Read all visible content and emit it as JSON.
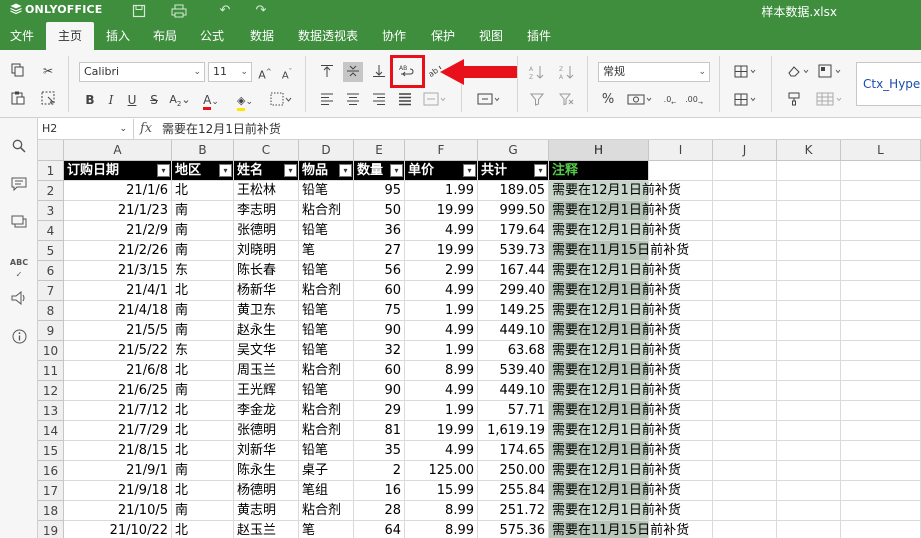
{
  "app": {
    "brand": "ONLYOFFICE",
    "filename": "样本数据.xlsx"
  },
  "menu": {
    "tabs": [
      "文件",
      "主页",
      "插入",
      "布局",
      "公式",
      "数据",
      "数据透视表",
      "协作",
      "保护",
      "视图",
      "插件"
    ],
    "active_index": 1
  },
  "toolbar": {
    "font_name": "Calibri",
    "font_size": "11",
    "number_format": "常规",
    "style_preview": "Ctx_Hype",
    "highlighted_button": "wrap-text-button",
    "arrow_color": "#e8101a"
  },
  "formula_bar": {
    "cell_ref": "H2",
    "fx_label": "fx",
    "value": "需要在12月1日前补货"
  },
  "grid": {
    "columns": [
      "A",
      "B",
      "C",
      "D",
      "E",
      "F",
      "G",
      "H",
      "I",
      "J",
      "K",
      "L"
    ],
    "selected_column": "H",
    "row_numbers": [
      "1",
      "2",
      "3",
      "4",
      "5",
      "6",
      "7",
      "8",
      "9",
      "10",
      "11",
      "12",
      "13",
      "14",
      "15",
      "16",
      "17",
      "18",
      "19"
    ],
    "header_row": [
      "订购日期",
      "地区",
      "姓名",
      "物品",
      "数量",
      "单价",
      "共计",
      "注释"
    ],
    "rows": [
      [
        "21/1/6",
        "北",
        "王松林",
        "铅笔",
        "95",
        "1.99",
        "189.05",
        "需要在12月1日前补货"
      ],
      [
        "21/1/23",
        "南",
        "李志明",
        "粘合剂",
        "50",
        "19.99",
        "999.50",
        "需要在12月1日前补货"
      ],
      [
        "21/2/9",
        "南",
        "张德明",
        "铅笔",
        "36",
        "4.99",
        "179.64",
        "需要在12月1日前补货"
      ],
      [
        "21/2/26",
        "南",
        "刘晓明",
        "笔",
        "27",
        "19.99",
        "539.73",
        "需要在11月15日前补货"
      ],
      [
        "21/3/15",
        "东",
        "陈长春",
        "铅笔",
        "56",
        "2.99",
        "167.44",
        "需要在12月1日前补货"
      ],
      [
        "21/4/1",
        "北",
        "杨新华",
        "粘合剂",
        "60",
        "4.99",
        "299.40",
        "需要在12月1日前补货"
      ],
      [
        "21/4/18",
        "南",
        "黄卫东",
        "铅笔",
        "75",
        "1.99",
        "149.25",
        "需要在12月1日前补货"
      ],
      [
        "21/5/5",
        "南",
        "赵永生",
        "铅笔",
        "90",
        "4.99",
        "449.10",
        "需要在12月1日前补货"
      ],
      [
        "21/5/22",
        "东",
        "吴文华",
        "铅笔",
        "32",
        "1.99",
        "63.68",
        "需要在12月1日前补货"
      ],
      [
        "21/6/8",
        "北",
        "周玉兰",
        "粘合剂",
        "60",
        "8.99",
        "539.40",
        "需要在12月1日前补货"
      ],
      [
        "21/6/25",
        "南",
        "王光辉",
        "铅笔",
        "90",
        "4.99",
        "449.10",
        "需要在12月1日前补货"
      ],
      [
        "21/7/12",
        "北",
        "李金龙",
        "粘合剂",
        "29",
        "1.99",
        "57.71",
        "需要在12月1日前补货"
      ],
      [
        "21/7/29",
        "北",
        "张德明",
        "粘合剂",
        "81",
        "19.99",
        "1,619.19",
        "需要在12月1日前补货"
      ],
      [
        "21/8/15",
        "北",
        "刘新华",
        "铅笔",
        "35",
        "4.99",
        "174.65",
        "需要在12月1日前补货"
      ],
      [
        "21/9/1",
        "南",
        "陈永生",
        "桌子",
        "2",
        "125.00",
        "250.00",
        "需要在12月1日前补货"
      ],
      [
        "21/9/18",
        "北",
        "杨德明",
        "笔组",
        "16",
        "15.99",
        "255.84",
        "需要在12月1日前补货"
      ],
      [
        "21/10/5",
        "南",
        "黄志明",
        "粘合剂",
        "28",
        "8.99",
        "251.72",
        "需要在12月1日前补货"
      ],
      [
        "21/10/22",
        "北",
        "赵玉兰",
        "笔",
        "64",
        "8.99",
        "575.36",
        "需要在11月15日前补货"
      ]
    ]
  }
}
